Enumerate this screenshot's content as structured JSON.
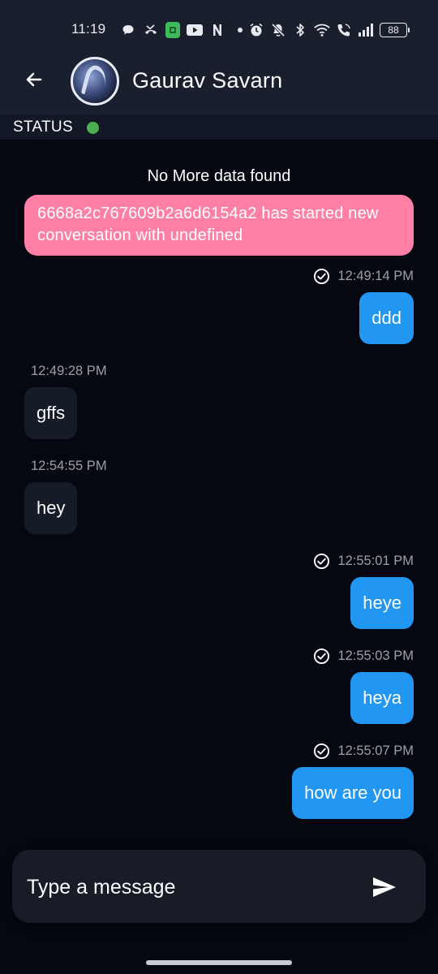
{
  "status_bar": {
    "time": "11:19",
    "battery": "88",
    "icons": [
      "chat-bubble-icon",
      "missed-call-icon",
      "green-app-icon",
      "youtube-icon",
      "n-app-icon",
      "dot-icon",
      "alarm-icon",
      "mute-icon",
      "bluetooth-icon",
      "wifi-icon",
      "wifi-call-icon",
      "signal-icon",
      "battery-icon"
    ]
  },
  "header": {
    "contact_name": "Gaurav Savarn",
    "status_label": "STATUS",
    "status_color": "#4caf50",
    "background": "#1a1f2e"
  },
  "chat": {
    "no_more_text": "No More data found",
    "system_message": "6668a2c767609b2a6d6154a2 has started new conversation with undefined",
    "system_color": "#ff7fa5",
    "outgoing_color": "#2196f3",
    "incoming_color": "#161c27",
    "messages": [
      {
        "direction": "out",
        "time": "12:49:14 PM",
        "text": "ddd",
        "read": true
      },
      {
        "direction": "in",
        "time": "12:49:28 PM",
        "text": "gffs"
      },
      {
        "direction": "in",
        "time": "12:54:55 PM",
        "text": "hey"
      },
      {
        "direction": "out",
        "time": "12:55:01 PM",
        "text": "heye",
        "read": true
      },
      {
        "direction": "out",
        "time": "12:55:03 PM",
        "text": "heya",
        "read": true
      },
      {
        "direction": "out",
        "time": "12:55:07 PM",
        "text": "how are you",
        "read": true
      }
    ]
  },
  "composer": {
    "placeholder": "Type a message",
    "value": ""
  }
}
